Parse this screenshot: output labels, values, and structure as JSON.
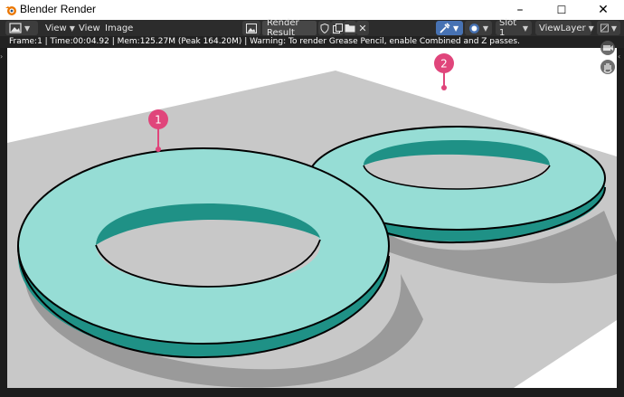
{
  "window": {
    "title": "Blender Render",
    "controls": {
      "minimize": "–",
      "maximize": "☐",
      "close": "✕"
    }
  },
  "toolbar": {
    "view_menu_1": "View",
    "view_menu_2": "View",
    "image_menu": "Image",
    "render_result": "Render Result",
    "slot": "Slot 1",
    "view_layer": "ViewLayer"
  },
  "status": {
    "text": "Frame:1 | Time:00:04.92 | Mem:125.27M (Peak 164.20M) | Warning: To render Grease Pencil, enable Combined and Z passes."
  },
  "render": {
    "markers": [
      {
        "label": "1"
      },
      {
        "label": "2"
      }
    ],
    "colors": {
      "ground": "#c8c8c8",
      "torus_top": "#96ddd5",
      "torus_side": "#1f9186",
      "shadow": "#9c9c9c",
      "marker": "#e0457b",
      "outline": "#000000"
    }
  },
  "icons": {
    "app": "blender-icon",
    "editor_type": "image-editor-icon",
    "shield": "fake-user-shield-icon",
    "duplicate": "duplicate-icon",
    "folder": "open-folder-icon",
    "close": "close-icon",
    "sample": "sample-tool-icon",
    "display": "display-channels-icon",
    "sidebar": "sidebar-icon",
    "camera": "camera-icon",
    "hand": "pan-hand-icon"
  }
}
